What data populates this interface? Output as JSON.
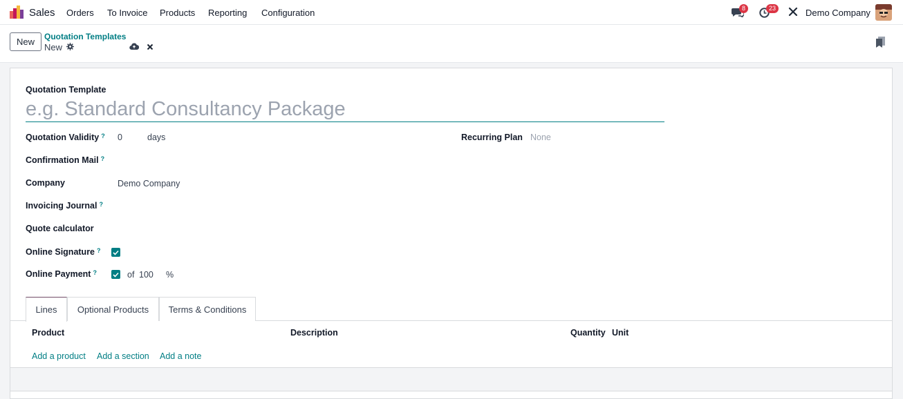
{
  "navbar": {
    "app_name": "Sales",
    "menu": [
      "Orders",
      "To Invoice",
      "Products",
      "Reporting",
      "Configuration"
    ],
    "messages_count": "8",
    "activities_count": "23",
    "company": "Demo Company",
    "icons": [
      "apps-logo",
      "chat-icon",
      "clock-icon",
      "tools-icon",
      "avatar"
    ]
  },
  "control": {
    "new_button": "New",
    "breadcrumb_parent": "Quotation Templates",
    "breadcrumb_current": "New"
  },
  "form": {
    "name_label": "Quotation Template",
    "name_placeholder": "e.g. Standard Consultancy Package",
    "validity_label": "Quotation Validity",
    "validity_value": "0",
    "validity_unit": "days",
    "recurring_label": "Recurring Plan",
    "recurring_value": "None",
    "confirmation_mail_label": "Confirmation Mail",
    "company_label": "Company",
    "company_value": "Demo Company",
    "invoicing_journal_label": "Invoicing Journal",
    "quote_calculator_label": "Quote calculator",
    "online_signature_label": "Online Signature",
    "online_signature_checked": true,
    "online_payment_label": "Online Payment",
    "online_payment_checked": true,
    "payment_of": "of",
    "payment_percent": "100",
    "percent_sign": "%",
    "help_mark": "?"
  },
  "tabs": [
    "Lines",
    "Optional Products",
    "Terms & Conditions"
  ],
  "table": {
    "columns": [
      "Product",
      "Description",
      "Quantity",
      "Unit"
    ],
    "actions": [
      "Add a product",
      "Add a section",
      "Add a note"
    ]
  },
  "colors": {
    "accent": "#017e84",
    "brand": "#714b67",
    "badge": "#dc3545"
  }
}
